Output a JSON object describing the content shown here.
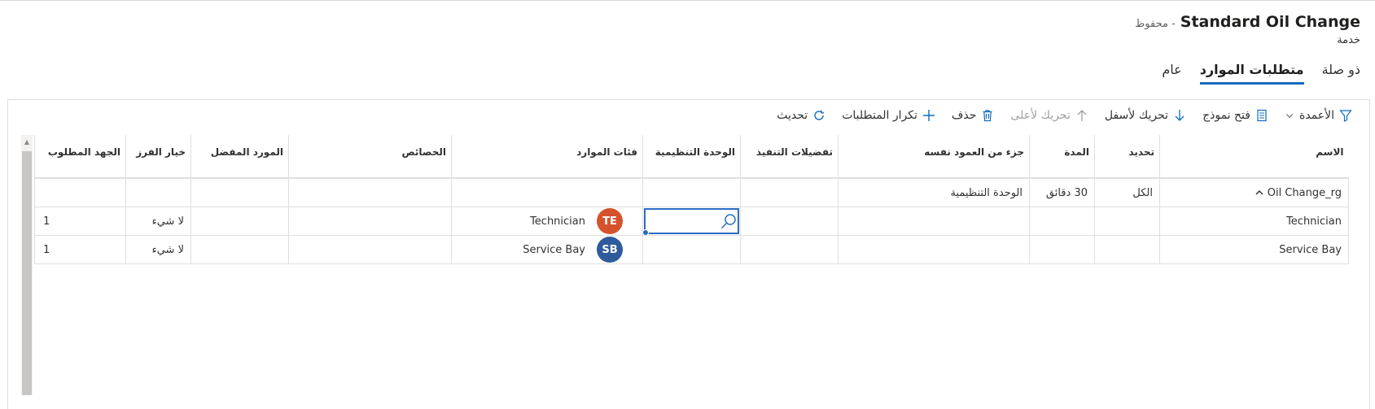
{
  "header": {
    "title": "Standard Oil Change",
    "saved_status": "- محفوظ",
    "entity": "خدمة"
  },
  "tabs": [
    {
      "label": "عام"
    },
    {
      "label": "متطلبات الموارد"
    },
    {
      "label": "ذو صلة"
    }
  ],
  "commands": {
    "refresh": "تحديث",
    "duplicate": "تكرار المتطلبات",
    "delete": "حذف",
    "move_up": "تحريك لأعلى",
    "move_down": "تحريك لأسفل",
    "open_form": "فتح نموذج",
    "columns": "الأعمدة"
  },
  "grid": {
    "columns": [
      "الاسم",
      "تحديد",
      "المدة",
      "جزء من العمود نفسه",
      "تفضيلات التنفيذ",
      "الوحدة التنظيمية",
      "فئات الموارد",
      "الخصائص",
      "المورد المفضل",
      "خيار الفرز",
      "الجهد المطلوب"
    ],
    "rows": [
      {
        "name": "Oil Change_rg",
        "select": "الكل",
        "duration": "30 دقائق",
        "same_column": "الوحدة التنظيمية",
        "execution": "",
        "org_unit": "",
        "category": "",
        "category_initials": "",
        "characteristics": "",
        "preferred": "",
        "sort": "",
        "effort": ""
      },
      {
        "name": "Technician",
        "select": "",
        "duration": "",
        "same_column": "",
        "execution": "",
        "org_unit": "",
        "category": "Technician",
        "category_initials": "TE",
        "characteristics": "",
        "preferred": "",
        "sort": "لا شيء",
        "effort": "1"
      },
      {
        "name": "Service Bay",
        "select": "",
        "duration": "",
        "same_column": "",
        "execution": "",
        "org_unit": "",
        "category": "Service Bay",
        "category_initials": "SB",
        "characteristics": "",
        "preferred": "",
        "sort": "لا شيء",
        "effort": "1"
      }
    ]
  },
  "colors": {
    "accent": "#0f6cbd",
    "avatar_te": "#d5532c",
    "avatar_sb": "#2f5b9c"
  }
}
